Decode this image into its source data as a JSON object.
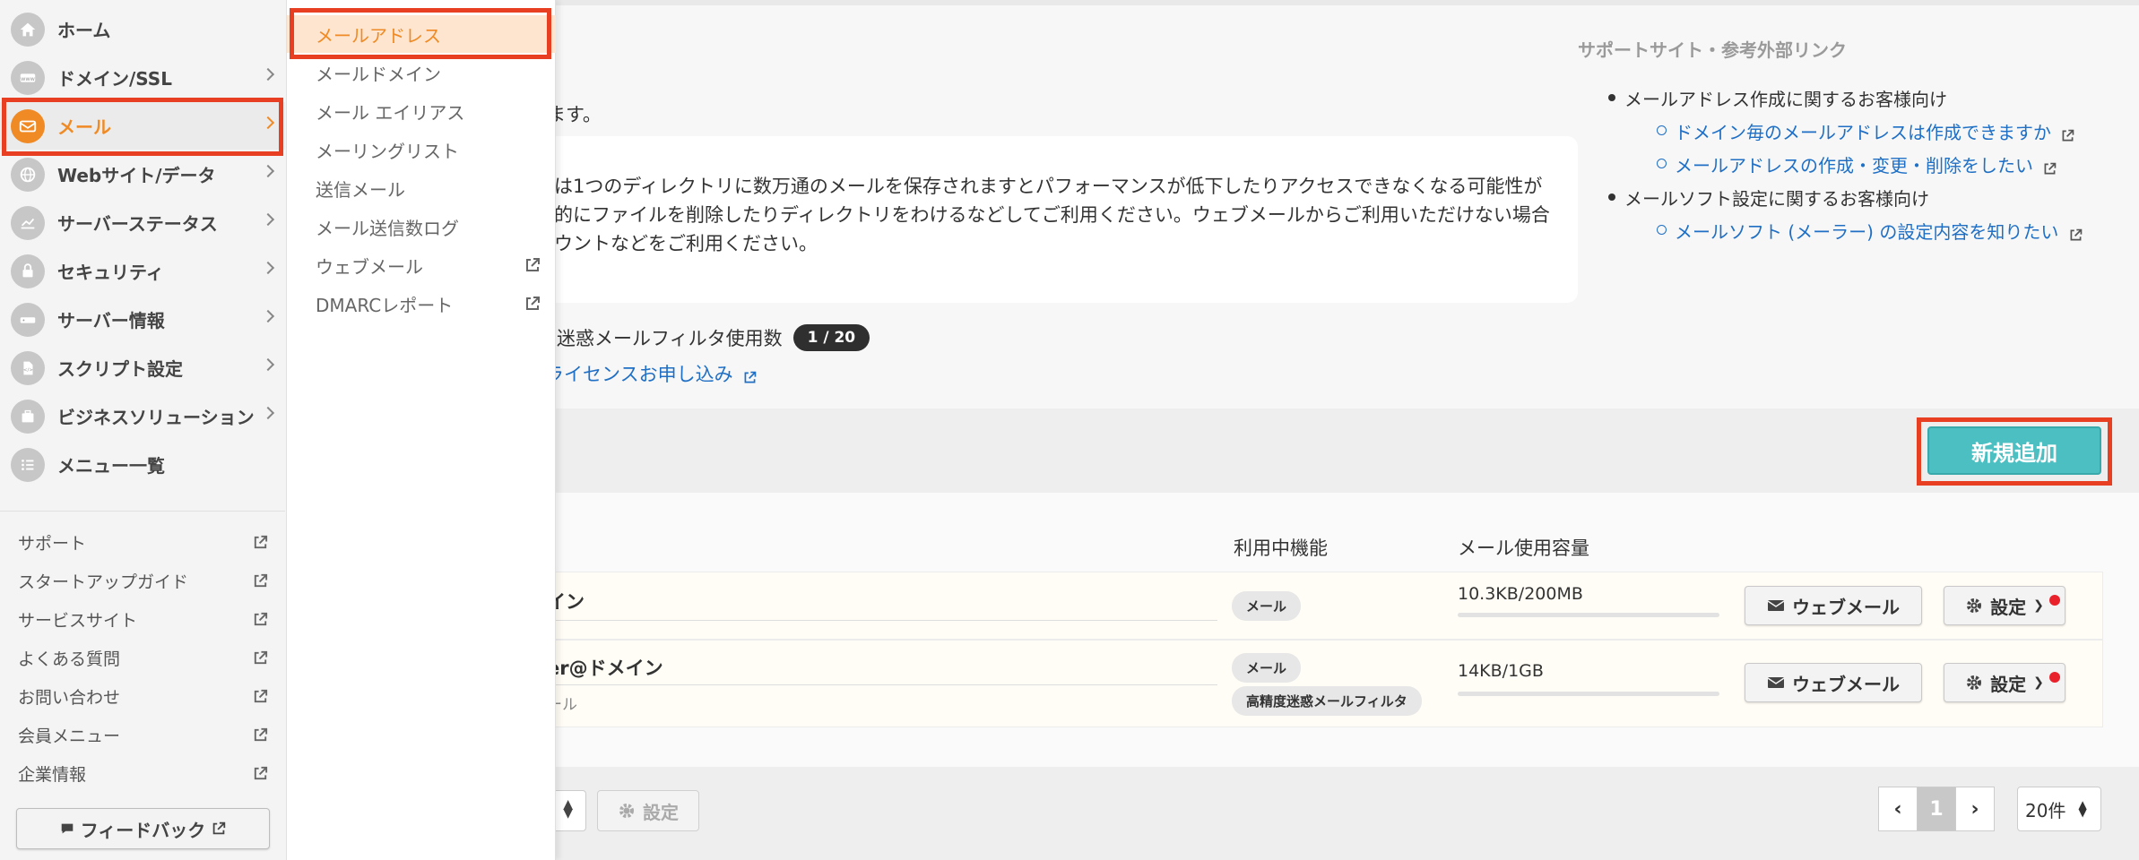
{
  "sidebar": {
    "items": [
      {
        "label": "ホーム",
        "icon": "home-icon"
      },
      {
        "label": "ドメイン/SSL",
        "icon": "domain-icon"
      },
      {
        "label": "メール",
        "icon": "mail-icon"
      },
      {
        "label": "Webサイト/データ",
        "icon": "globe-icon"
      },
      {
        "label": "サーバーステータス",
        "icon": "chart-icon"
      },
      {
        "label": "セキュリティ",
        "icon": "lock-icon"
      },
      {
        "label": "サーバー情報",
        "icon": "server-icon"
      },
      {
        "label": "スクリプト設定",
        "icon": "script-icon"
      },
      {
        "label": "ビジネスソリューション",
        "icon": "briefcase-icon"
      },
      {
        "label": "メニュー一覧",
        "icon": "list-icon"
      }
    ],
    "links": [
      "サポート",
      "スタートアップガイド",
      "サービスサイト",
      "よくある質問",
      "お問い合わせ",
      "会員メニュー",
      "企業情報"
    ],
    "feedback_label": "フィードバック"
  },
  "submenu": {
    "items": [
      "メールアドレス",
      "メールドメイン",
      "メール エイリアス",
      "メーリングリスト",
      "送信メール",
      "メール送信数ログ",
      "ウェブメール",
      "DMARCレポート"
    ]
  },
  "main": {
    "intro_tail": "ます。",
    "notice_lines": [
      "は1つのディレクトリに数万通のメールを保存されますとパフォーマンスが低下したりアクセスできなくなる可能性が",
      "的にファイルを削除したりディレクトリをわけるなどしてご利用ください。ウェブメールからご利用いただけない場合",
      "ウントなどをご利用ください。"
    ],
    "filter_label": "度迷惑メールフィルタ使用数",
    "filter_count": "1 / 20",
    "license_link": "ライセンスお申し込み",
    "support": {
      "title": "サポートサイト・参考外部リンク",
      "groups": [
        {
          "label": "メールアドレス作成に関するお客様向け",
          "links": [
            "ドメイン毎のメールアドレスは作成できますか",
            "メールアドレスの作成・変更・削除をしたい"
          ]
        },
        {
          "label": "メールソフト設定に関するお客様向け",
          "links": [
            "メールソフト (メーラー) の設定内容を知りたい"
          ]
        }
      ]
    },
    "add_button": "新規追加",
    "table": {
      "headers": {
        "features": "利用中機能",
        "usage": "メール使用容量"
      },
      "rows": [
        {
          "account": "イン",
          "sub": "",
          "features": [
            "メール"
          ],
          "usage": "10.3KB/200MB",
          "usage_ratio": 0.0,
          "webmail": "ウェブメール",
          "settings": "設定"
        },
        {
          "account": "er@ドメイン",
          "sub": "ール",
          "features": [
            "メール",
            "高精度迷惑メールフィルタ"
          ],
          "usage": "14KB/1GB",
          "usage_ratio": 0.0,
          "webmail": "ウェブメール",
          "settings": "設定"
        }
      ]
    },
    "footer": {
      "settings_label": "設定",
      "page": "1",
      "per_page": "20件"
    }
  }
}
